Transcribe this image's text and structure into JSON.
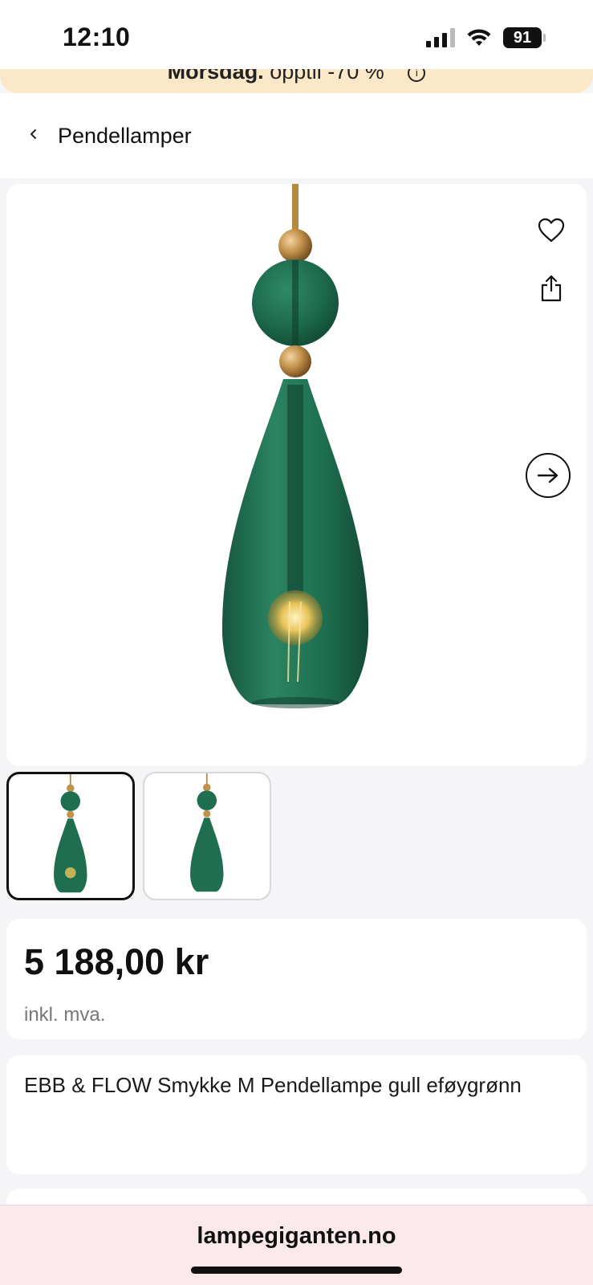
{
  "status_bar": {
    "time": "12:10",
    "battery": "91",
    "icons": [
      "cellular-signal-icon",
      "wifi-icon",
      "battery-icon"
    ]
  },
  "promo_banner": {
    "bold_text": "Morsdag.",
    "text": "opptil -70 %",
    "icon": "info-icon"
  },
  "nav": {
    "back_icon": "chevron-left-icon",
    "title": "Pendellamper"
  },
  "gallery": {
    "actions": [
      "heart-icon",
      "share-icon"
    ],
    "next_icon": "arrow-right-icon",
    "thumbnails": [
      "product-image-1",
      "product-image-2"
    ],
    "selected_index": 0
  },
  "product": {
    "price": "5 188,00 kr",
    "vat_note": "inkl. mva.",
    "title": "EBB & FLOW Smykke M Pendellampe gull eføygrønn"
  },
  "browser": {
    "url": "lampegiganten.no"
  },
  "colors": {
    "promo_bg": "#fbe8c8",
    "glass_green": "#1f6e4f",
    "brass": "#b8893a",
    "url_bar_bg": "#fbe9ec"
  }
}
